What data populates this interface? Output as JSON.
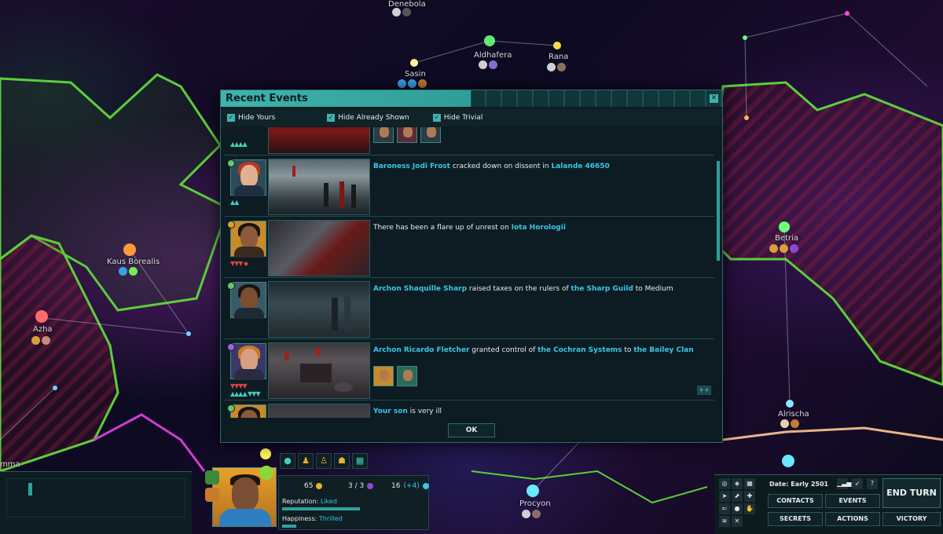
{
  "map": {
    "stars": [
      {
        "name": "Denebola"
      },
      {
        "name": "Sasin"
      },
      {
        "name": "Aldhafera"
      },
      {
        "name": "Rana"
      },
      {
        "name": "Kaus Borealis"
      },
      {
        "name": "Azha"
      },
      {
        "name": "Betria"
      },
      {
        "name": "Alrischa"
      },
      {
        "name": "Procyon"
      },
      {
        "name": "mma"
      }
    ]
  },
  "dialog": {
    "title": "Recent Events",
    "close_icon": "close-icon",
    "filters": [
      {
        "label": "Hide Yours",
        "checked": true
      },
      {
        "label": "Hide Already Shown",
        "checked": true
      },
      {
        "label": "Hide Trivial",
        "checked": true
      }
    ],
    "events": [
      {
        "parts": [
          {
            "text": "Baroness Jodi Frost",
            "hl": true
          },
          {
            "text": " cracked down on dissent in ",
            "hl": false
          },
          {
            "text": "Lalande 46650",
            "hl": true
          }
        ]
      },
      {
        "parts": [
          {
            "text": "There has been a flare up of unrest on ",
            "hl": false
          },
          {
            "text": "Iota Horologii",
            "hl": true
          }
        ]
      },
      {
        "parts": [
          {
            "text": "Archon Shaquille Sharp",
            "hl": true
          },
          {
            "text": " raised taxes on the rulers of ",
            "hl": false
          },
          {
            "text": "the Sharp Guild",
            "hl": true
          },
          {
            "text": " to Medium",
            "hl": false
          }
        ]
      },
      {
        "parts": [
          {
            "text": "Archon Ricardo Fletcher",
            "hl": true
          },
          {
            "text": " granted control of ",
            "hl": false
          },
          {
            "text": "the Cochran Systems",
            "hl": true
          },
          {
            "text": " to ",
            "hl": false
          },
          {
            "text": "the Bailey Clan",
            "hl": true
          }
        ]
      },
      {
        "parts": [
          {
            "text": "Your son",
            "hl": true
          },
          {
            "text": " is very ill",
            "hl": false
          }
        ]
      }
    ],
    "ok_label": "OK"
  },
  "hud": {
    "stats": {
      "wealth": "65",
      "pop": "3 / 3",
      "influence": "16",
      "influence_delta": "(+4)"
    },
    "reputation_label": "Reputation:",
    "reputation_value": "Liked",
    "reputation_level": 0.55,
    "happiness_label": "Happiness:",
    "happiness_value": "Thrilled",
    "happiness_level": 0.1,
    "date": "Date: Early 2501",
    "buttons": {
      "contacts": "CONTACTS",
      "events": "EVENTS",
      "secrets": "SECRETS",
      "actions": "ACTIONS",
      "victory": "VICTORY",
      "end_turn": "END TURN",
      "help": "?"
    }
  },
  "colors": {
    "accent": "#3fb3ad",
    "highlight": "#38c7e8",
    "territory_green": "#5bcf3a",
    "territory_peach": "#e9b488",
    "territory_pink": "#d43ad4"
  }
}
